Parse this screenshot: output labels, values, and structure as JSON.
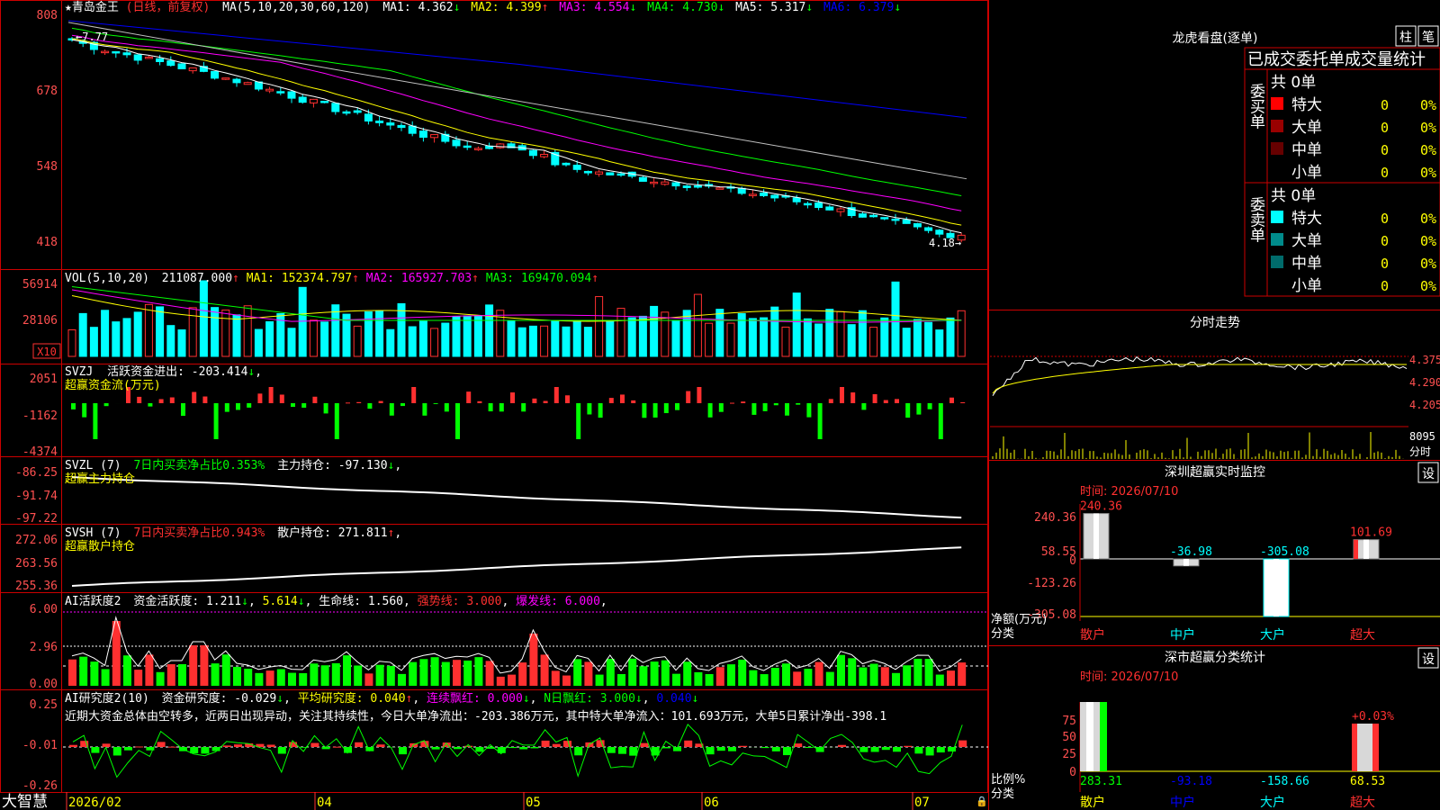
{
  "colors": {
    "up": "#ff3030",
    "down": "#00ffff",
    "grid": "#cc0000",
    "yellow": "#ffff00",
    "magenta": "#ff00ff",
    "green": "#00ff00",
    "blue": "#0000ff",
    "white": "#ffffff",
    "gray": "#c0c0c0",
    "axis": "#ff5050",
    "darkred": "#800000",
    "teal": "#008080"
  },
  "header": {
    "title": "★青岛金王",
    "period": "(日线，前复权)",
    "ma_title": "MA(5,10,20,30,60,120)",
    "ma1": "MA1: 4.362",
    "ma2": "MA2: 4.399",
    "ma3": "MA3: 4.554",
    "ma4": "MA4: 4.730",
    "ma5": "MA5: 5.317",
    "ma6": "MA6: 6.379",
    "high_label": "7.77",
    "low_label": "4.18"
  },
  "price_axis": [
    "808",
    "678",
    "548",
    "418"
  ],
  "vol_panel": {
    "title": "VOL(5,10,20)",
    "value": "211087.000",
    "ma1": "MA1: 152374.797",
    "ma2": "MA2: 165927.703",
    "ma3": "MA3: 169470.094",
    "axis": [
      "56914",
      "28106"
    ],
    "unit": "X10"
  },
  "svzj_panel": {
    "title": "SVZJ",
    "label": "活跃资金进出: -203.414",
    "sub": "超赢资金流(万元)",
    "axis": [
      "2051",
      "-1162",
      "-4374"
    ]
  },
  "svzl_panel": {
    "title": "SVZL (7)",
    "ratio": "7日内买卖净占比0.353%",
    "label": "主力持仓: -97.130",
    "sub": "超赢主力持仓",
    "axis": [
      "-86.25",
      "-91.74",
      "-97.22"
    ]
  },
  "svsh_panel": {
    "title": "SVSH (7)",
    "ratio": "7日内买卖净占比0.943%",
    "label": "散户持仓: 271.811",
    "sub": "超赢散户持仓",
    "axis": [
      "272.06",
      "263.56",
      "255.36"
    ]
  },
  "ai_act_panel": {
    "title": "AI活跃度2",
    "label": "资金活跃度: 1.211",
    "v2": "5.614",
    "life": "生命线: 1.560",
    "strong": "强势线: 3.000",
    "burst": "爆发线: 6.000",
    "axis": [
      "6.00",
      "2.96",
      "0.00"
    ]
  },
  "ai_res_panel": {
    "title": "AI研究度2(10)",
    "label": "资金研究度: -0.029",
    "avg": "平均研究度: 0.040",
    "red": "连续飘红: 0.000",
    "nday": "N日飘红: 3.000",
    "last": "0.040",
    "comment": "近期大资金总体由空转多，近两日出现异动，关注其持续性，今日大单净流出：-203.386万元，其中特大单净流入：101.693万元，大单5日累计净出-398.1",
    "axis": [
      "0.25",
      "-0.01",
      "-0.26"
    ]
  },
  "bottom": {
    "brand": "大智慧",
    "dates": [
      "2026/02",
      "04",
      "05",
      "06",
      "07"
    ]
  },
  "dragon": {
    "title": "龙虎看盘(逐单)",
    "btn1": "柱",
    "btn2": "笔",
    "subtitle": "已成交委托单成交量统计",
    "buy_label": "委买单",
    "sell_label": "委卖单",
    "buy_total": "共 0单",
    "sell_total": "共 0单",
    "buy_rows": [
      {
        "name": "特大",
        "val": "0",
        "pct": "0%",
        "color": "#ff0000"
      },
      {
        "name": "大单",
        "val": "0",
        "pct": "0%",
        "color": "#990000"
      },
      {
        "name": "中单",
        "val": "0",
        "pct": "0%",
        "color": "#660000"
      },
      {
        "name": "小单",
        "val": "0",
        "pct": "0%",
        "color": ""
      }
    ],
    "sell_rows": [
      {
        "name": "特大",
        "val": "0",
        "pct": "0%",
        "color": "#00ffff"
      },
      {
        "name": "大单",
        "val": "0",
        "pct": "0%",
        "color": "#008b8b"
      },
      {
        "name": "中单",
        "val": "0",
        "pct": "0%",
        "color": "#006b6b"
      },
      {
        "name": "小单",
        "val": "0",
        "pct": "0%",
        "color": ""
      }
    ]
  },
  "intraday": {
    "title": "分时走势",
    "axis": [
      "4.375",
      "4.290",
      "4.205"
    ],
    "vol": "8095",
    "vol_label": "分时"
  },
  "sz_monitor": {
    "title": "深圳超赢实时监控",
    "btn": "设",
    "time": "时间: 2026/07/10",
    "axis": [
      "240.36",
      "58.55",
      "0",
      "-123.26",
      "-305.08"
    ],
    "ylabel": "净额(万元)",
    "xlabel": "分类",
    "categories": [
      "散户",
      "中户",
      "大户",
      "超大"
    ],
    "values": [
      240.36,
      -36.98,
      -305.08,
      101.69
    ],
    "value_labels": [
      "240.36",
      "-36.98",
      "-305.08",
      "101.69"
    ]
  },
  "sz_class": {
    "title": "深市超赢分类统计",
    "btn": "设",
    "time": "时间: 2026/07/10",
    "axis": [
      "75",
      "50",
      "25",
      "0"
    ],
    "ylabel": "比例%",
    "xlabel": "分类",
    "categories": [
      "散户",
      "中户",
      "大户",
      "超大"
    ],
    "bottom_values": [
      "283.31",
      "-93.18",
      "-158.66",
      "68.53"
    ],
    "pct_label": "+0.03%"
  },
  "chart_data": [
    {
      "type": "candlestick",
      "title": "青岛金王 日线 前复权",
      "ylim": [
        4.18,
        8.08
      ],
      "x": [
        "2026/02",
        "04",
        "05",
        "06",
        "07"
      ],
      "high": 7.77,
      "low": 4.18,
      "ma": {
        "MA1": 4.362,
        "MA2": 4.399,
        "MA3": 4.554,
        "MA4": 4.73,
        "MA5": 5.317,
        "MA6": 6.379
      }
    },
    {
      "type": "bar",
      "title": "深圳超赢实时监控",
      "categories": [
        "散户",
        "中户",
        "大户",
        "超大"
      ],
      "values": [
        240.36,
        -36.98,
        -305.08,
        101.69
      ],
      "ylim": [
        -305.08,
        240.36
      ]
    },
    {
      "type": "bar",
      "title": "深市超赢分类统计",
      "categories": [
        "散户",
        "中户",
        "大户",
        "超大"
      ],
      "values": [
        283.31,
        -93.18,
        -158.66,
        68.53
      ]
    }
  ]
}
